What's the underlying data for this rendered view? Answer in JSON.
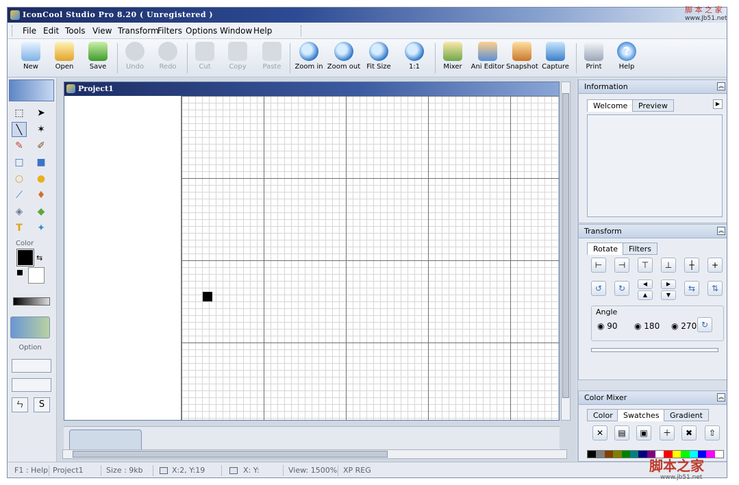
{
  "window": {
    "title": "IconCool Studio Pro 8.20 ( Unregistered )"
  },
  "menu": [
    "File",
    "Edit",
    "Tools",
    "View",
    "Transform",
    "Filters",
    "Options",
    "Window",
    "Help"
  ],
  "toolbar": [
    {
      "label": "New",
      "icon": "new-document-icon",
      "enabled": true
    },
    {
      "label": "Open",
      "icon": "open-folder-icon",
      "enabled": true
    },
    {
      "label": "Save",
      "icon": "save-disk-icon",
      "enabled": true
    },
    {
      "label": "Undo",
      "icon": "undo-icon",
      "enabled": false
    },
    {
      "label": "Redo",
      "icon": "redo-icon",
      "enabled": false
    },
    {
      "label": "Cut",
      "icon": "cut-icon",
      "enabled": false
    },
    {
      "label": "Copy",
      "icon": "copy-icon",
      "enabled": false
    },
    {
      "label": "Paste",
      "icon": "paste-icon",
      "enabled": false
    },
    {
      "label": "Zoom in",
      "icon": "zoom-in-icon",
      "enabled": true
    },
    {
      "label": "Zoom out",
      "icon": "zoom-out-icon",
      "enabled": true
    },
    {
      "label": "Fit Size",
      "icon": "fit-size-icon",
      "enabled": true
    },
    {
      "label": "1:1",
      "icon": "actual-size-icon",
      "enabled": true
    },
    {
      "label": "Mixer",
      "icon": "mixer-icon",
      "enabled": true
    },
    {
      "label": "Ani Editor",
      "icon": "ani-editor-icon",
      "enabled": true
    },
    {
      "label": "Snapshot",
      "icon": "snapshot-icon",
      "enabled": true
    },
    {
      "label": "Capture",
      "icon": "capture-icon",
      "enabled": true
    },
    {
      "label": "Print",
      "icon": "print-icon",
      "enabled": true
    },
    {
      "label": "Help",
      "icon": "help-icon",
      "enabled": true
    }
  ],
  "left": {
    "color_label": "Color",
    "option_label": "Option",
    "text_tool": "S"
  },
  "document": {
    "title": "Project1"
  },
  "info_panel": {
    "title": "Information",
    "tabs": [
      "Welcome",
      "Preview"
    ]
  },
  "transform_panel": {
    "title": "Transform",
    "tabs": [
      "Rotate",
      "Filters"
    ],
    "angle_label": "Angle",
    "angles": [
      "90",
      "180",
      "270"
    ]
  },
  "mixer_panel": {
    "title": "Color Mixer",
    "tabs": [
      "Color",
      "Swatches",
      "Gradient"
    ]
  },
  "status": {
    "help": "F1 : Help",
    "project": "Project1",
    "size": "Size : 9kb",
    "coords": "X:2, Y:19",
    "coords2": "X: Y:",
    "view": "View: 1500%",
    "reg": "XP REG"
  },
  "watermark": {
    "top": "脚 本 之 家",
    "top_url": "www.Jb51.net",
    "bottom": "脚本之家",
    "bottom_url": "www.jb51.net"
  },
  "colors": {
    "accent": "#2d4a93",
    "palette": [
      "#000000",
      "#7f7f7f",
      "#804000",
      "#808000",
      "#008000",
      "#008080",
      "#000080",
      "#800080",
      "#ffffff",
      "#ff0000",
      "#ffff00",
      "#00ff00",
      "#00ffff",
      "#0000ff",
      "#ff00ff",
      "#ffffff"
    ]
  }
}
